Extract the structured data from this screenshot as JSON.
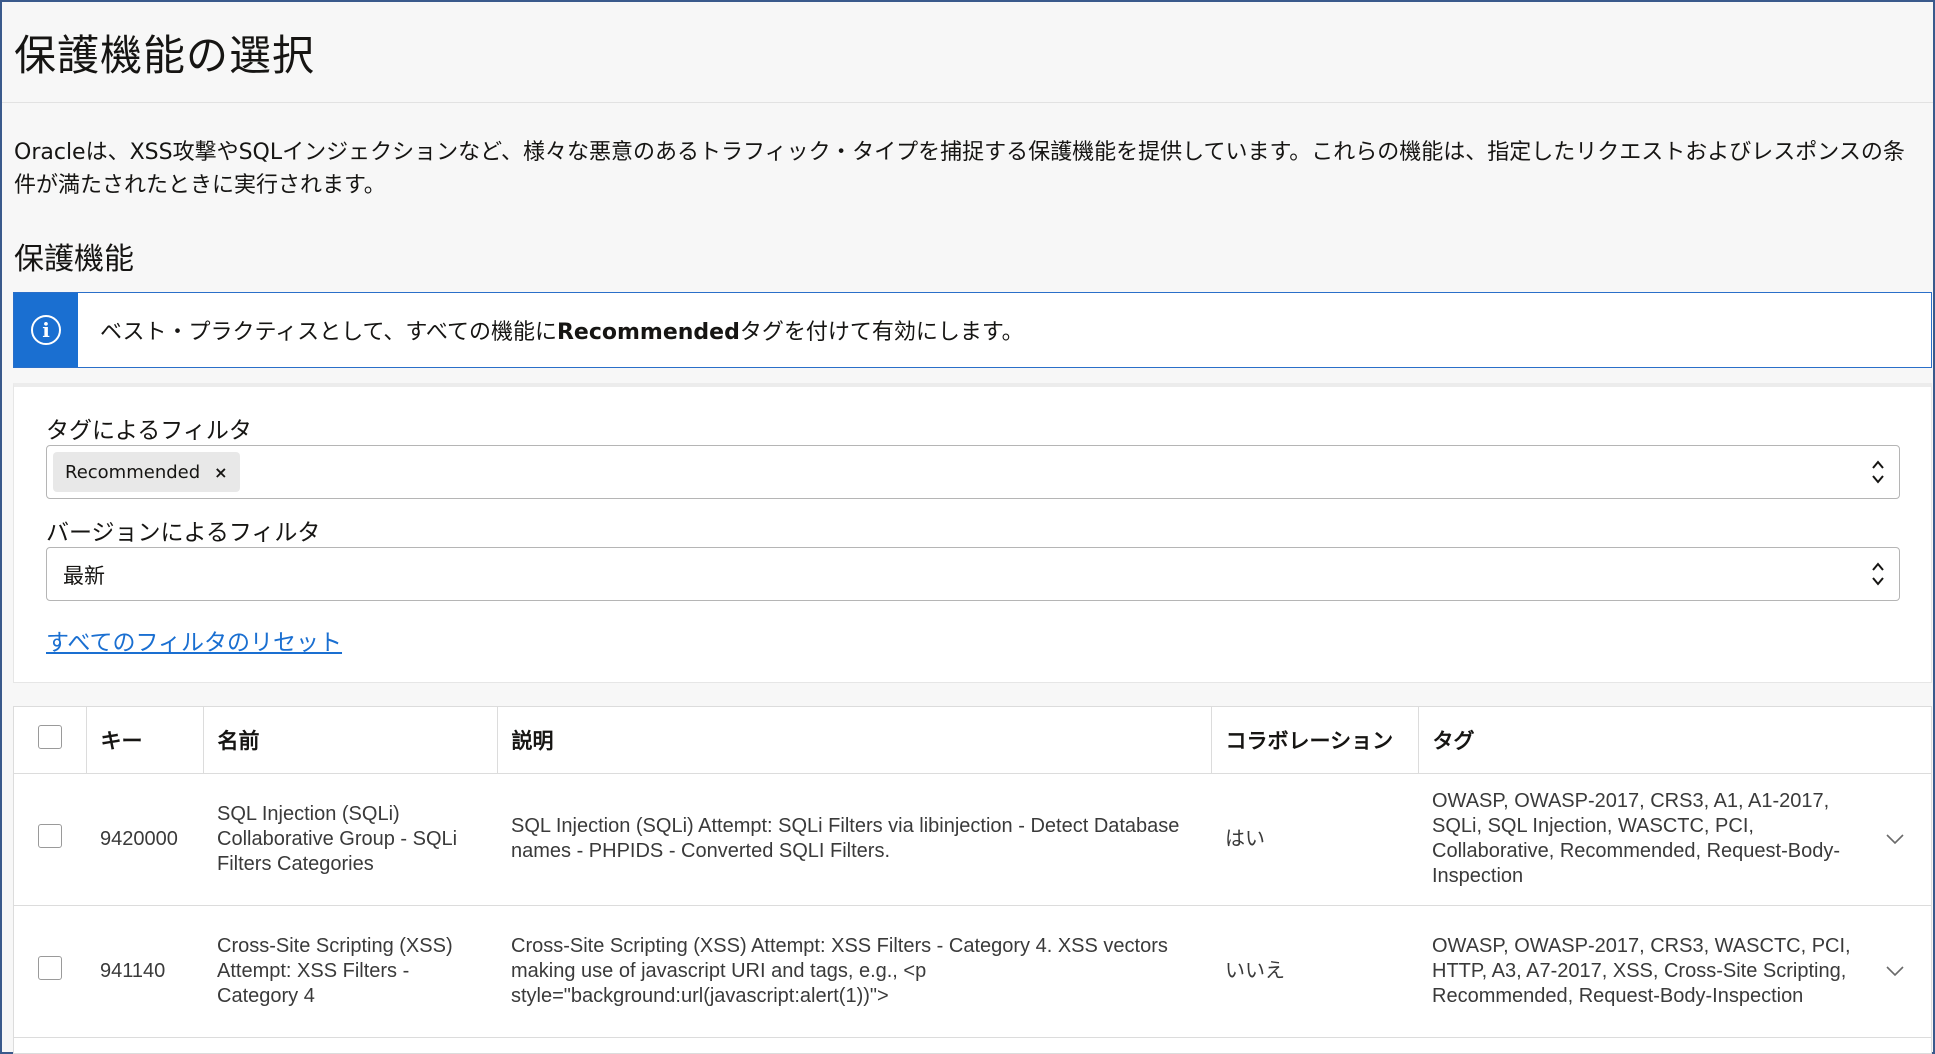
{
  "page": {
    "title": "保護機能の選択",
    "intro": "Oracleは、XSS攻撃やSQLインジェクションなど、様々な悪意のあるトラフィック・タイプを捕捉する保護機能を提供しています。これらの機能は、指定したリクエストおよびレスポンスの条件が満たされたときに実行されます。",
    "section_title": "保護機能"
  },
  "info": {
    "icon": "info-icon",
    "text_before": "ベスト・プラクティスとして、すべての機能に",
    "text_bold": "Recommended",
    "text_after": "タグを付けて有効にします。"
  },
  "filters": {
    "tag_label": "タグによるフィルタ",
    "tag_chip": "Recommended",
    "tag_chip_remove": "×",
    "version_label": "バージョンによるフィルタ",
    "version_value": "最新",
    "reset_link": "すべてのフィルタのリセット"
  },
  "table": {
    "headers": {
      "key": "キー",
      "name": "名前",
      "description": "説明",
      "correlation": "コラボレーション",
      "tags": "タグ"
    },
    "rows": [
      {
        "key": "9420000",
        "name": "SQL Injection (SQLi) Collaborative Group - SQLi Filters Categories",
        "description": "SQL Injection (SQLi) Attempt: SQLi Filters via libinjection - Detect Database names - PHPIDS - Converted SQLI Filters.",
        "correlation": "はい",
        "tags": "OWASP, OWASP-2017, CRS3, A1, A1-2017, SQLi, SQL Injection, WASCTC, PCI, Collaborative, Recommended, Request-Body-Inspection"
      },
      {
        "key": "941140",
        "name": "Cross-Site Scripting (XSS) Attempt: XSS Filters - Category 4",
        "description": "Cross-Site Scripting (XSS) Attempt: XSS Filters - Category 4. XSS vectors making use of javascript URI and tags, e.g., <p style=\"background:url(javascript:alert(1))\">",
        "correlation": "いいえ",
        "tags": "OWASP, OWASP-2017, CRS3, WASCTC, PCI, HTTP, A3, A7-2017, XSS, Cross-Site Scripting, Recommended, Request-Body-Inspection"
      }
    ]
  }
}
